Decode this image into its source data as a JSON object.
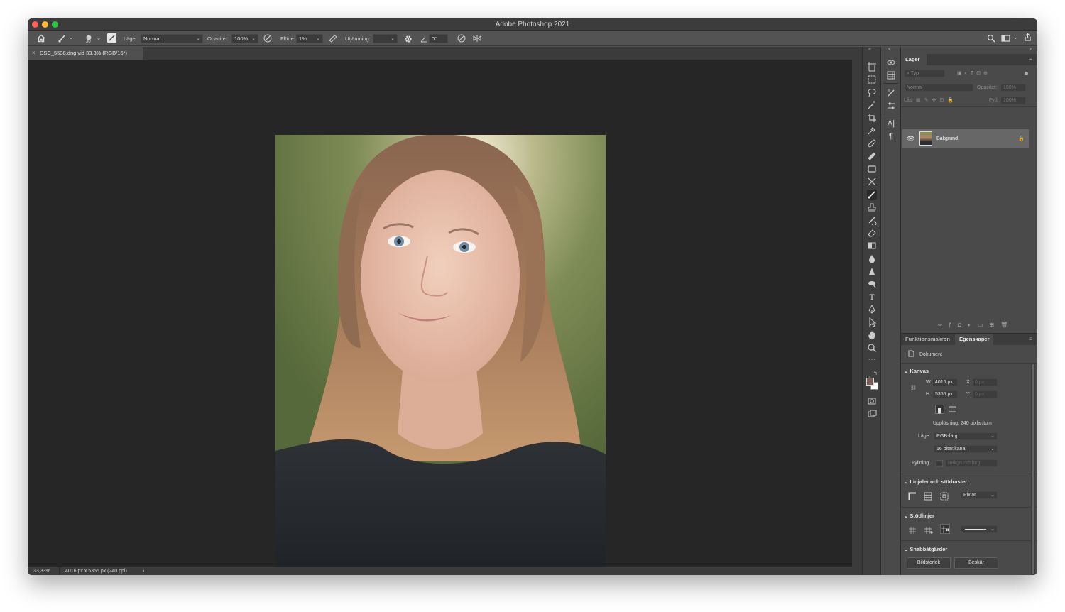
{
  "window": {
    "title": "Adobe Photoshop 2021",
    "traffic_colors": [
      "#ff5f57",
      "#febc2e",
      "#28c840"
    ]
  },
  "options_bar": {
    "brush_size": "30",
    "mode_label": "Läge:",
    "mode_value": "Normal",
    "opacity_label": "Opacitet:",
    "opacity_value": "100%",
    "flow_label": "Flöde:",
    "flow_value": "1%",
    "smoothing_label": "Utjämning:",
    "smoothing_value": "",
    "angle_value": "0°"
  },
  "document": {
    "tab_label": "DSC_5538.dng vid 33,3% (RGB/16*)",
    "zoom": "33,33%",
    "info": "4016 px x 5355 px (240 ppi)"
  },
  "tools": [
    "move-tool",
    "artboard-tool",
    "marquee-tool",
    "lasso-tool",
    "magic-wand-tool",
    "crop-tool",
    "eyedropper-tool",
    "healing-tool",
    "patch-tool",
    "frame-tool",
    "content-aware-move-tool",
    "brush-tool",
    "clone-stamp-tool",
    "history-brush-tool",
    "eraser-tool",
    "gradient-tool",
    "blur-tool",
    "sharpen-tool",
    "dodge-tool",
    "type-tool",
    "pen-tool",
    "path-selection-tool",
    "hand-tool",
    "zoom-tool"
  ],
  "layers_panel": {
    "tab": "Lager",
    "search_placeholder": "Typ",
    "blend_mode": "Normal",
    "opacity_label": "Opacitet:",
    "opacity_value": "100%",
    "lock_label": "Lås:",
    "fill_label": "Fyll:",
    "fill_value": "100%",
    "layer_name": "Bakgrund"
  },
  "properties_panel": {
    "tab_actions": "Funktionsmakron",
    "tab_properties": "Egenskaper",
    "doc_label": "Dokument",
    "canvas_section": "Kanvas",
    "width_label": "W",
    "width_value": "4016 px",
    "height_label": "H",
    "height_value": "5355 px",
    "x_label": "X",
    "x_value": "0 px",
    "y_label": "Y",
    "y_value": "0 px",
    "resolution": "Upplösning: 240 pixlar/tum",
    "mode_label": "Läge",
    "mode_value": "RGB-färg",
    "depth_value": "16 bitar/kanal",
    "fill_label": "Fyllning",
    "fill_value": "Bakgrundsfärg",
    "rulers_section": "Linjaler och stödraster",
    "ruler_unit": "Pixlar",
    "guides_section": "Stödlinjer",
    "quick_section": "Snabbåtgärder",
    "btn_image_size": "Bildstorlek",
    "btn_crop": "Beskär"
  },
  "colors": {
    "foreground": "#7a5c57",
    "background": "#ffffff"
  }
}
